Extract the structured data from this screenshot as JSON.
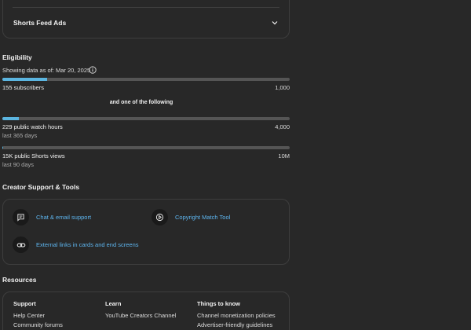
{
  "ads": {
    "label": "Shorts Feed Ads"
  },
  "eligibility": {
    "title": "Eligibility",
    "as_of": "Showing data as of: Mar 20, 2025",
    "subscribers": {
      "label": "155 subscribers",
      "goal": "1,000",
      "progress": 0.155
    },
    "connector": "and one of the following",
    "watch_hours": {
      "label": "229 public watch hours",
      "sub": "last 365 days",
      "goal": "4,000",
      "progress": 0.0573
    },
    "shorts_views": {
      "label": "15K public Shorts views",
      "sub": "last 90 days",
      "goal": "10M",
      "progress": 0.0015
    }
  },
  "support": {
    "title": "Creator Support & Tools",
    "tools": [
      {
        "label": "Chat & email support",
        "icon": "chat-icon"
      },
      {
        "label": "Copyright Match Tool",
        "icon": "copyright-match-icon"
      },
      {
        "label": "External links in cards and end screens",
        "icon": "link-icon"
      }
    ]
  },
  "resources": {
    "title": "Resources",
    "columns": [
      {
        "head": "Support",
        "links": [
          "Help Center",
          "Community forums"
        ]
      },
      {
        "head": "Learn",
        "links": [
          "YouTube Creators Channel"
        ]
      },
      {
        "head": "Things to know",
        "links": [
          "Channel monetization policies",
          "Advertiser-friendly guidelines"
        ]
      }
    ]
  },
  "colors": {
    "accent": "#5bb5e0",
    "link": "#5eb6f0",
    "background": "#282828",
    "track": "#555555"
  }
}
